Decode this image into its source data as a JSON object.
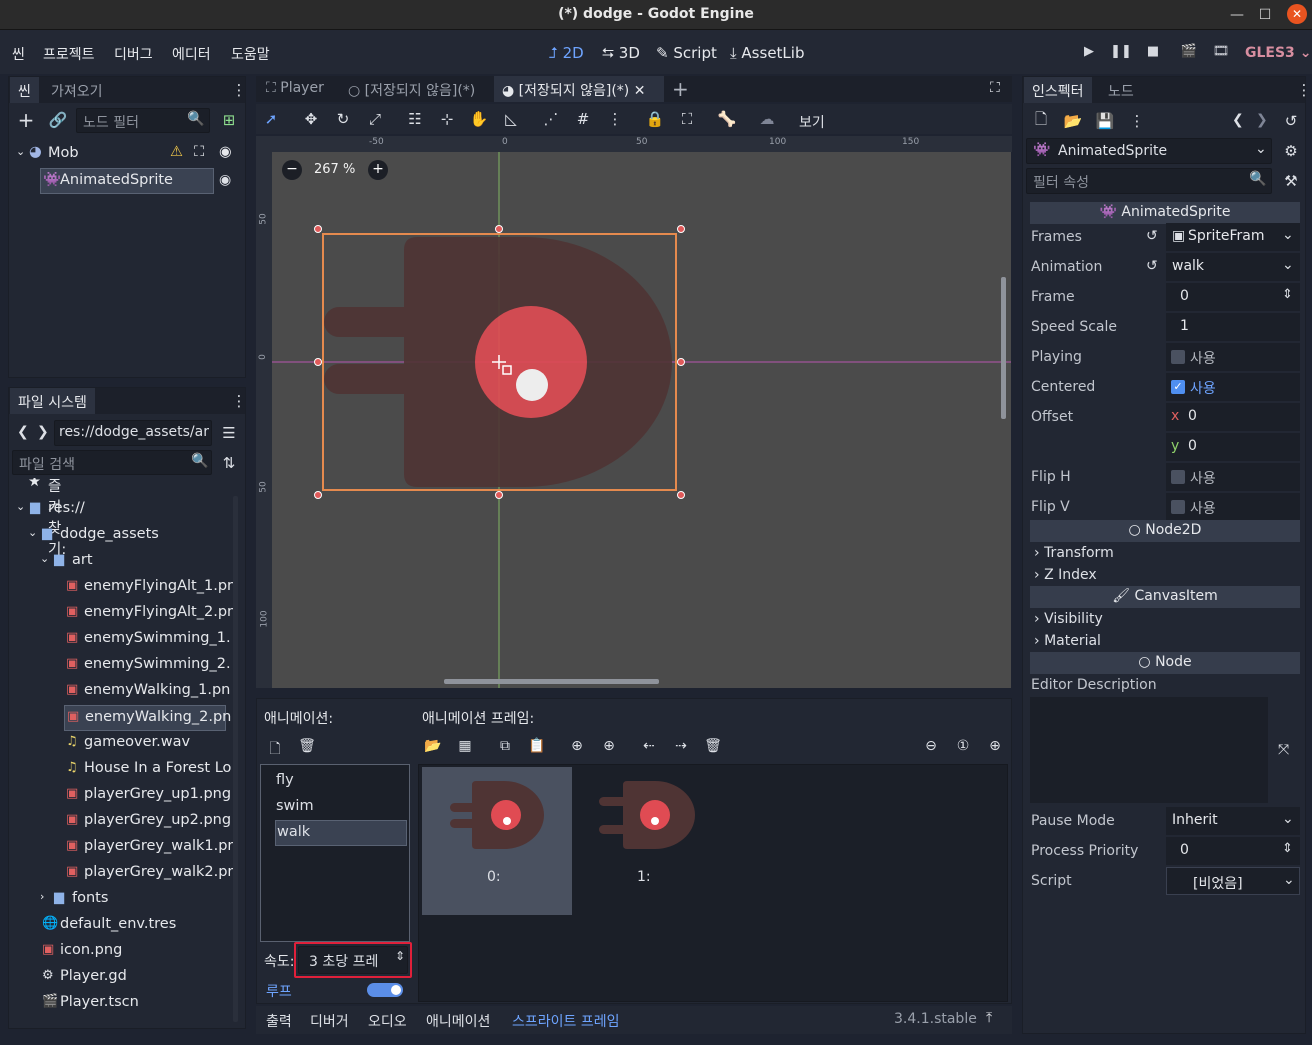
{
  "window": {
    "title": "(*) dodge - Godot Engine"
  },
  "menu": [
    "씬",
    "프로젝트",
    "디버그",
    "에디터",
    "도움말"
  ],
  "workspaces": {
    "2d": "2D",
    "3d": "3D",
    "script": "Script",
    "assetlib": "AssetLib"
  },
  "renderer": "GLES3",
  "scene_dock": {
    "tabs": [
      "씬",
      "가져오기"
    ],
    "filter_placeholder": "노드 필터",
    "root": "Mob",
    "child": "AnimatedSprite"
  },
  "filesystem": {
    "tab": "파일 시스템",
    "path": "res://dodge_assets/art",
    "search_placeholder": "파일 검색",
    "favorites": "즐겨찾기:",
    "items": [
      {
        "label": "res://",
        "depth": 0,
        "kind": "folder"
      },
      {
        "label": "dodge_assets",
        "depth": 1,
        "kind": "folder"
      },
      {
        "label": "art",
        "depth": 2,
        "kind": "folder"
      },
      {
        "label": "enemyFlyingAlt_1.pn",
        "depth": 3,
        "kind": "img"
      },
      {
        "label": "enemyFlyingAlt_2.pn",
        "depth": 3,
        "kind": "img"
      },
      {
        "label": "enemySwimming_1.",
        "depth": 3,
        "kind": "img"
      },
      {
        "label": "enemySwimming_2.",
        "depth": 3,
        "kind": "img"
      },
      {
        "label": "enemyWalking_1.pn",
        "depth": 3,
        "kind": "img"
      },
      {
        "label": "enemyWalking_2.pn",
        "depth": 3,
        "kind": "img"
      },
      {
        "label": "gameover.wav",
        "depth": 3,
        "kind": "audio"
      },
      {
        "label": "House In a Forest Lo",
        "depth": 3,
        "kind": "audio"
      },
      {
        "label": "playerGrey_up1.png",
        "depth": 3,
        "kind": "img"
      },
      {
        "label": "playerGrey_up2.png",
        "depth": 3,
        "kind": "img"
      },
      {
        "label": "playerGrey_walk1.pn",
        "depth": 3,
        "kind": "img"
      },
      {
        "label": "playerGrey_walk2.pn",
        "depth": 3,
        "kind": "img"
      },
      {
        "label": "fonts",
        "depth": 2,
        "kind": "folder"
      },
      {
        "label": "default_env.tres",
        "depth": 1,
        "kind": "env"
      },
      {
        "label": "icon.png",
        "depth": 1,
        "kind": "img"
      },
      {
        "label": "Player.gd",
        "depth": 1,
        "kind": "gd"
      },
      {
        "label": "Player.tscn",
        "depth": 1,
        "kind": "scene"
      }
    ]
  },
  "editor_tabs": [
    "Player",
    "[저장되지 않음](*)",
    "[저장되지 않음](*)"
  ],
  "view_menu": "보기",
  "zoom": "267 %",
  "ruler": {
    "h": [
      "-50",
      "0",
      "50",
      "100",
      "150"
    ],
    "v": [
      "50",
      "0",
      "50",
      "100"
    ]
  },
  "animation_panel": {
    "animations_label": "애니메이션:",
    "frames_label": "애니메이션 프레임:",
    "animations": [
      "fly",
      "swim",
      "walk"
    ],
    "selected": "walk",
    "speed_label": "속도:",
    "speed_value": "3 초당 프레",
    "loop_label": "루프",
    "frames": [
      "0:",
      "1:"
    ]
  },
  "bottom_tabs": [
    "출력",
    "디버거",
    "오디오",
    "애니메이션",
    "스프라이트 프레임"
  ],
  "version": "3.4.1.stable",
  "inspector": {
    "tabs": [
      "인스펙터",
      "노드"
    ],
    "object": "AnimatedSprite",
    "filter_placeholder": "필터 속성",
    "section_main": "AnimatedSprite",
    "props": {
      "frames": {
        "label": "Frames",
        "value": "SpriteFram"
      },
      "animation": {
        "label": "Animation",
        "value": "walk"
      },
      "frame": {
        "label": "Frame",
        "value": "0"
      },
      "speed_scale": {
        "label": "Speed Scale",
        "value": "1"
      },
      "playing": {
        "label": "Playing",
        "value": "사용"
      },
      "centered": {
        "label": "Centered",
        "value": "사용"
      },
      "offset": {
        "label": "Offset",
        "x_label": "x",
        "x": "0",
        "y_label": "y",
        "y": "0"
      },
      "flip_h": {
        "label": "Flip H",
        "value": "사용"
      },
      "flip_v": {
        "label": "Flip V",
        "value": "사용"
      }
    },
    "node2d": "Node2D",
    "transform": "Transform",
    "z_index": "Z Index",
    "canvasitem": "CanvasItem",
    "visibility": "Visibility",
    "material": "Material",
    "node": "Node",
    "editor_description": "Editor Description",
    "pause_mode": {
      "label": "Pause Mode",
      "value": "Inherit"
    },
    "process_priority": {
      "label": "Process Priority",
      "value": "0"
    },
    "script": {
      "label": "Script",
      "value": "[비었음]"
    }
  },
  "colors": {
    "accent": "#6ea4ff",
    "selection_box": "#e58a4e",
    "enemy_body": "#4f3434",
    "enemy_eye": "#e04b53"
  }
}
